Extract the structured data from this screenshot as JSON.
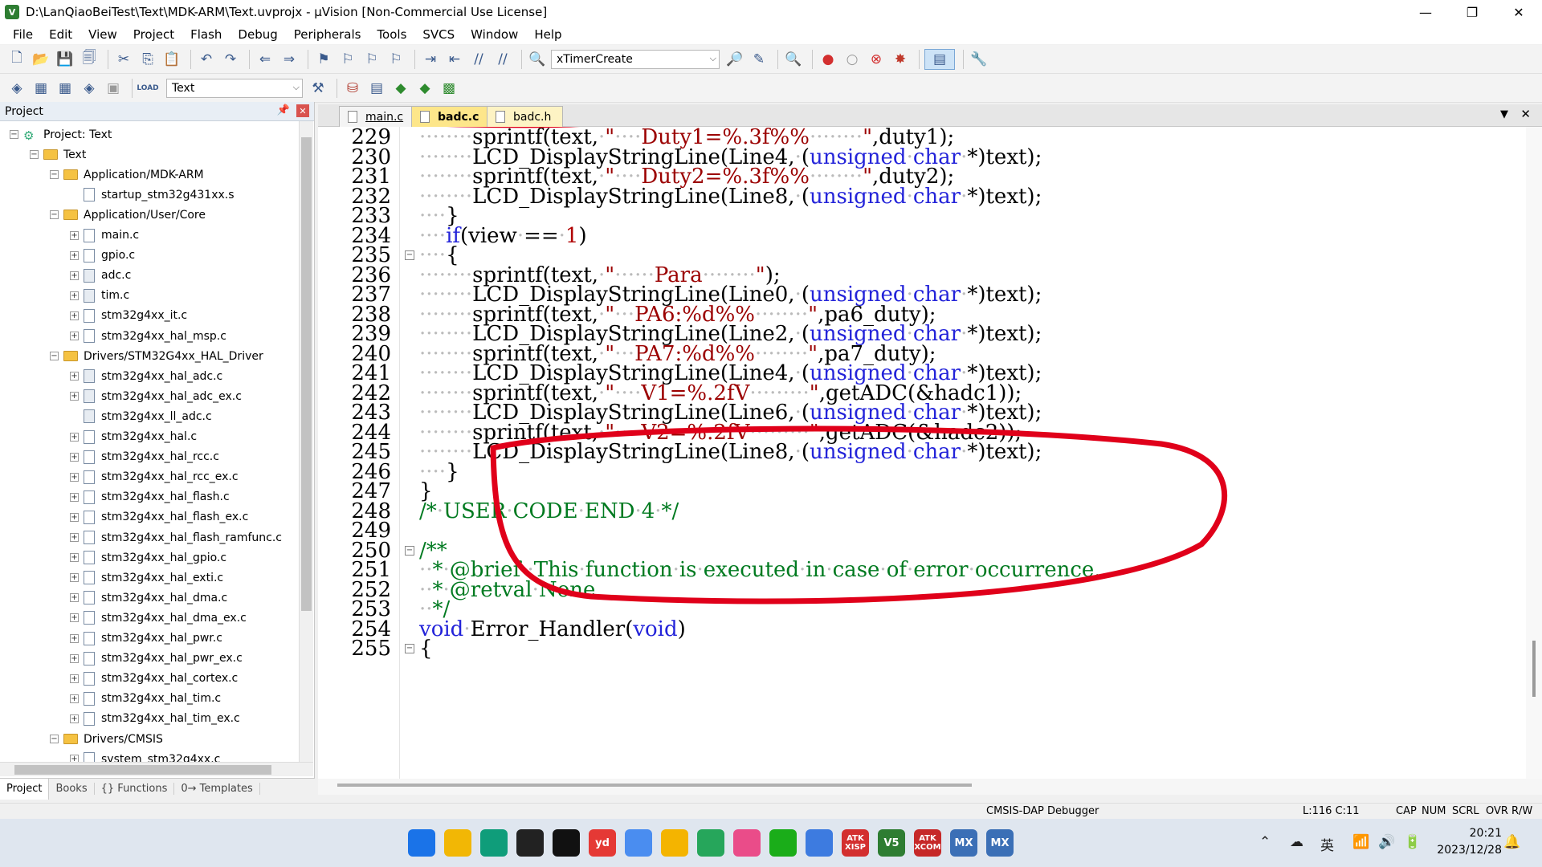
{
  "window": {
    "title": "D:\\LanQiaoBeiTest\\Text\\MDK-ARM\\Text.uvprojx - µVision  [Non-Commercial Use License]",
    "minimize": "—",
    "maximize": "❐",
    "close": "✕"
  },
  "menu": [
    "File",
    "Edit",
    "View",
    "Project",
    "Flash",
    "Debug",
    "Peripherals",
    "Tools",
    "SVCS",
    "Window",
    "Help"
  ],
  "toolbar1": {
    "function_combo": "xTimerCreate"
  },
  "toolbar2": {
    "target_combo": "Text",
    "load_label": "LOAD"
  },
  "project_panel": {
    "title": "Project",
    "tree": [
      {
        "label": "Project: Text",
        "indent": 0,
        "type": "project",
        "exp": "−"
      },
      {
        "label": "Text",
        "indent": 1,
        "type": "folder",
        "exp": "−"
      },
      {
        "label": "Application/MDK-ARM",
        "indent": 2,
        "type": "folder",
        "exp": "−"
      },
      {
        "label": "startup_stm32g431xx.s",
        "indent": 3,
        "type": "file",
        "exp": ""
      },
      {
        "label": "Application/User/Core",
        "indent": 2,
        "type": "folder",
        "exp": "−"
      },
      {
        "label": "main.c",
        "indent": 3,
        "type": "file",
        "exp": "+"
      },
      {
        "label": "gpio.c",
        "indent": 3,
        "type": "file",
        "exp": "+"
      },
      {
        "label": "adc.c",
        "indent": 3,
        "type": "lib",
        "exp": "+"
      },
      {
        "label": "tim.c",
        "indent": 3,
        "type": "lib",
        "exp": "+"
      },
      {
        "label": "stm32g4xx_it.c",
        "indent": 3,
        "type": "file",
        "exp": "+"
      },
      {
        "label": "stm32g4xx_hal_msp.c",
        "indent": 3,
        "type": "file",
        "exp": "+"
      },
      {
        "label": "Drivers/STM32G4xx_HAL_Driver",
        "indent": 2,
        "type": "folder",
        "exp": "−"
      },
      {
        "label": "stm32g4xx_hal_adc.c",
        "indent": 3,
        "type": "lib",
        "exp": "+"
      },
      {
        "label": "stm32g4xx_hal_adc_ex.c",
        "indent": 3,
        "type": "lib",
        "exp": "+"
      },
      {
        "label": "stm32g4xx_ll_adc.c",
        "indent": 3,
        "type": "lib",
        "exp": ""
      },
      {
        "label": "stm32g4xx_hal.c",
        "indent": 3,
        "type": "file",
        "exp": "+"
      },
      {
        "label": "stm32g4xx_hal_rcc.c",
        "indent": 3,
        "type": "file",
        "exp": "+"
      },
      {
        "label": "stm32g4xx_hal_rcc_ex.c",
        "indent": 3,
        "type": "file",
        "exp": "+"
      },
      {
        "label": "stm32g4xx_hal_flash.c",
        "indent": 3,
        "type": "file",
        "exp": "+"
      },
      {
        "label": "stm32g4xx_hal_flash_ex.c",
        "indent": 3,
        "type": "file",
        "exp": "+"
      },
      {
        "label": "stm32g4xx_hal_flash_ramfunc.c",
        "indent": 3,
        "type": "file",
        "exp": "+"
      },
      {
        "label": "stm32g4xx_hal_gpio.c",
        "indent": 3,
        "type": "file",
        "exp": "+"
      },
      {
        "label": "stm32g4xx_hal_exti.c",
        "indent": 3,
        "type": "file",
        "exp": "+"
      },
      {
        "label": "stm32g4xx_hal_dma.c",
        "indent": 3,
        "type": "file",
        "exp": "+"
      },
      {
        "label": "stm32g4xx_hal_dma_ex.c",
        "indent": 3,
        "type": "file",
        "exp": "+"
      },
      {
        "label": "stm32g4xx_hal_pwr.c",
        "indent": 3,
        "type": "file",
        "exp": "+"
      },
      {
        "label": "stm32g4xx_hal_pwr_ex.c",
        "indent": 3,
        "type": "file",
        "exp": "+"
      },
      {
        "label": "stm32g4xx_hal_cortex.c",
        "indent": 3,
        "type": "file",
        "exp": "+"
      },
      {
        "label": "stm32g4xx_hal_tim.c",
        "indent": 3,
        "type": "file",
        "exp": "+"
      },
      {
        "label": "stm32g4xx_hal_tim_ex.c",
        "indent": 3,
        "type": "file",
        "exp": "+"
      },
      {
        "label": "Drivers/CMSIS",
        "indent": 2,
        "type": "folder",
        "exp": "−"
      },
      {
        "label": "system_stm32g4xx.c",
        "indent": 3,
        "type": "file",
        "exp": "+"
      }
    ],
    "bottom_tabs": [
      "Project",
      "Books",
      "{} Functions",
      "0→ Templates"
    ]
  },
  "editor": {
    "tabs": [
      "main.c",
      "badc.c",
      "badc.h"
    ],
    "active_tab": "badc.c",
    "lines": [
      {
        "n": "229",
        "html": "········sprintf(text,·<span class='str'>\"····Duty1=%.3f%%········\"</span>,duty1);"
      },
      {
        "n": "230",
        "html": "········LCD_DisplayStringLine(Line4,·(<span class='kw'>unsigned</span>·<span class='kw'>char</span>·*)text);"
      },
      {
        "n": "231",
        "html": "········sprintf(text,·<span class='str'>\"····Duty2=%.3f%%········\"</span>,duty2);"
      },
      {
        "n": "232",
        "html": "········LCD_DisplayStringLine(Line8,·(<span class='kw'>unsigned</span>·<span class='kw'>char</span>·*)text);"
      },
      {
        "n": "233",
        "html": "····}"
      },
      {
        "n": "234",
        "html": "····<span class='kw'>if</span>(view·==·<span class='num'>1</span>)"
      },
      {
        "n": "235",
        "html": "····{"
      },
      {
        "n": "236",
        "html": "········sprintf(text,·<span class='str'>\"······Para········\"</span>);"
      },
      {
        "n": "237",
        "html": "········LCD_DisplayStringLine(Line0,·(<span class='kw'>unsigned</span>·<span class='kw'>char</span>·*)text);"
      },
      {
        "n": "238",
        "html": "········sprintf(text,·<span class='str'>\"···PA6:%d%%········\"</span>,pa6_duty);"
      },
      {
        "n": "239",
        "html": "········LCD_DisplayStringLine(Line2,·(<span class='kw'>unsigned</span>·<span class='kw'>char</span>·*)text);"
      },
      {
        "n": "240",
        "html": "········sprintf(text,·<span class='str'>\"···PA7:%d%%········\"</span>,pa7_duty);"
      },
      {
        "n": "241",
        "html": "········LCD_DisplayStringLine(Line4,·(<span class='kw'>unsigned</span>·<span class='kw'>char</span>·*)text);"
      },
      {
        "n": "242",
        "html": "········sprintf(text,·<span class='str'>\"····V1=%.2fV·········\"</span>,getADC(&amp;hadc1));"
      },
      {
        "n": "243",
        "html": "········LCD_DisplayStringLine(Line6,·(<span class='kw'>unsigned</span>·<span class='kw'>char</span>·*)text);"
      },
      {
        "n": "244",
        "html": "········sprintf(text,·<span class='str'>\"····V2=%.2fV·········\"</span>,getADC(&amp;hadc2));"
      },
      {
        "n": "245",
        "html": "········LCD_DisplayStringLine(Line8,·(<span class='kw'>unsigned</span>·<span class='kw'>char</span>·*)text);"
      },
      {
        "n": "246",
        "html": "····}"
      },
      {
        "n": "247",
        "html": "}"
      },
      {
        "n": "248",
        "html": "<span class='cm'>/*·USER·CODE·END·4·*/</span>"
      },
      {
        "n": "249",
        "html": ""
      },
      {
        "n": "250",
        "html": "<span class='cm'>/**</span>"
      },
      {
        "n": "251",
        "html": "<span class='cm'>··*·@brief··This·function·is·executed·in·case·of·error·occurrence.</span>"
      },
      {
        "n": "252",
        "html": "<span class='cm'>··*·@retval·None</span>"
      },
      {
        "n": "253",
        "html": "<span class='cm'>··*/</span>"
      },
      {
        "n": "254",
        "html": "<span class='kw'>void</span>·Error_Handler(<span class='kw'>void</span>)"
      },
      {
        "n": "255",
        "html": "{"
      }
    ],
    "fold_lines": [
      "235",
      "250",
      "255"
    ]
  },
  "status": {
    "debugger": "CMSIS-DAP Debugger",
    "position": "L:116 C:11",
    "caps": "CAP",
    "num": "NUM",
    "scrl": "SCRL",
    "ovr": "OVR",
    "rw": "R/W"
  },
  "taskbar": {
    "apps": [
      {
        "name": "start",
        "label": "",
        "color": "#1a73e8"
      },
      {
        "name": "file-explorer",
        "label": "",
        "color": "#f2b705"
      },
      {
        "name": "edge",
        "label": "",
        "color": "#0f9d7a"
      },
      {
        "name": "qq",
        "label": "",
        "color": "#222222"
      },
      {
        "name": "tiktok",
        "label": "",
        "color": "#111111"
      },
      {
        "name": "youdao",
        "label": "yd",
        "color": "#e53935"
      },
      {
        "name": "chat",
        "label": "",
        "color": "#4a8df0"
      },
      {
        "name": "browser",
        "label": "",
        "color": "#f4b400"
      },
      {
        "name": "player",
        "label": "",
        "color": "#26a65b"
      },
      {
        "name": "bilibili",
        "label": "",
        "color": "#ea4c89"
      },
      {
        "name": "wechat",
        "label": "",
        "color": "#1aad19"
      },
      {
        "name": "baidu-netdisk",
        "label": "",
        "color": "#3d7be0"
      },
      {
        "name": "atk-xisp",
        "label": "ATK XISP",
        "color": "#d32f2f"
      },
      {
        "name": "keil",
        "label": "V5",
        "color": "#2e7d32"
      },
      {
        "name": "atk-xcom",
        "label": "ATK XCOM",
        "color": "#c62828"
      },
      {
        "name": "stm32cubemx-1",
        "label": "MX",
        "color": "#3b6fb6"
      },
      {
        "name": "stm32cubemx-2",
        "label": "MX",
        "color": "#3b6fb6"
      }
    ],
    "ime": "英",
    "time": "20:21",
    "date": "2023/12/28"
  }
}
